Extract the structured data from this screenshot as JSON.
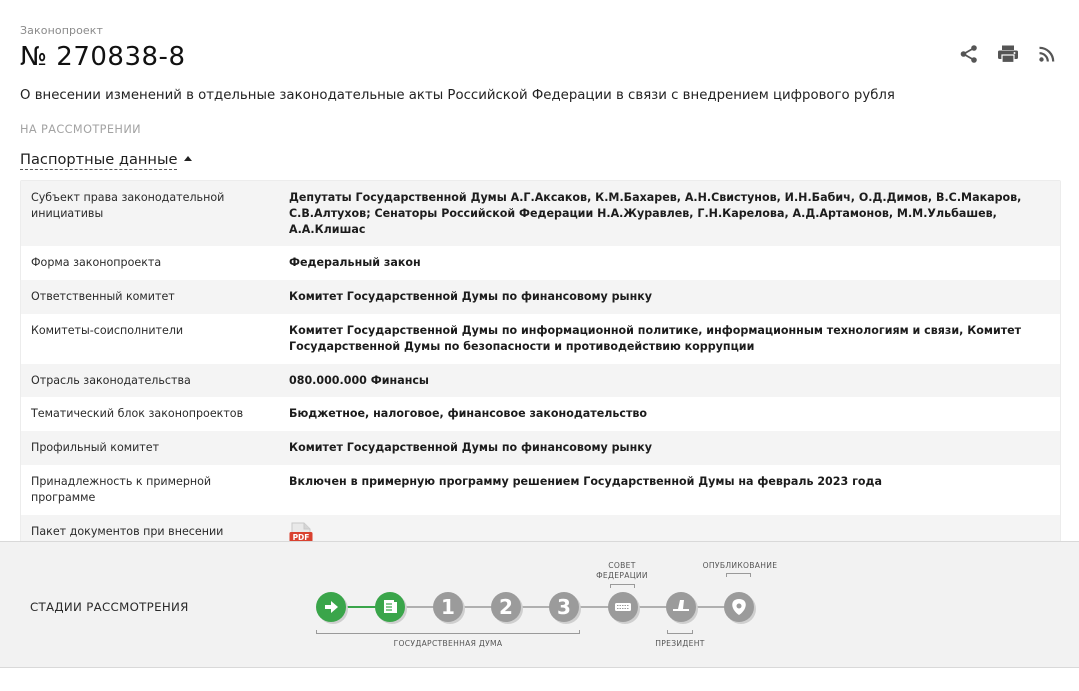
{
  "header": {
    "eyebrow": "Законопроект",
    "number": "№ 270838-8",
    "title": "О внесении изменений в отдельные законодательные акты Российской Федерации в связи с внедрением цифрового рубля",
    "status": "НА РАССМОТРЕНИИ",
    "passport_toggle": "Паспортные данные"
  },
  "tools": {
    "share_icon": "share-icon",
    "print_icon": "print-icon",
    "rss_icon": "rss-icon"
  },
  "passport": {
    "rows": [
      {
        "key": "Субъект права законодательной инициативы",
        "value": "Депутаты Государственной Думы А.Г.Аксаков, К.М.Бахарев, А.Н.Свистунов, И.Н.Бабич, О.Д.Димов, В.С.Макаров, С.В.Алтухов; Сенаторы Российской Федерации Н.А.Журавлев, Г.Н.Карелова, А.Д.Артамонов, М.М.Ульбашев, А.А.Клишас"
      },
      {
        "key": "Форма законопроекта",
        "value": "Федеральный закон"
      },
      {
        "key": "Ответственный комитет",
        "value": "Комитет Государственной Думы по финансовому рынку"
      },
      {
        "key": "Комитеты-соисполнители",
        "value": "Комитет Государственной Думы по информационной политике, информационным технологиям и связи, Комитет Государственной Думы по безопасности и противодействию коррупции"
      },
      {
        "key": "Отрасль законодательства",
        "value": "080.000.000 Финансы"
      },
      {
        "key": "Тематический блок законопроектов",
        "value": "Бюджетное, налоговое, финансовое законодательство"
      },
      {
        "key": "Профильный комитет",
        "value": "Комитет Государственной Думы по финансовому рынку"
      },
      {
        "key": "Принадлежность к примерной программе",
        "value": "Включен в примерную программу решением Государственной Думы на февраль 2023 года"
      },
      {
        "key": "Пакет документов при внесении",
        "value": ""
      }
    ],
    "pdf_label": "PDF"
  },
  "stages": {
    "label": "СТАДИИ РАССМОТРЕНИЯ",
    "duma_label": "ГОСУДАРСТВЕННАЯ ДУМА",
    "federation_council_label_1": "СОВЕТ",
    "federation_council_label_2": "ФЕДЕРАЦИИ",
    "president_label": "ПРЕЗИДЕНТ",
    "publication_label": "ОПУБЛИКОВАНИЕ",
    "steps": [
      {
        "name": "registration",
        "icon": "arrow-right-icon",
        "status": "done"
      },
      {
        "name": "preliminary",
        "icon": "document-list-icon",
        "status": "done"
      },
      {
        "name": "first-reading",
        "text": "1",
        "status": "pending"
      },
      {
        "name": "second-reading",
        "text": "2",
        "status": "pending"
      },
      {
        "name": "third-reading",
        "text": "3",
        "status": "pending"
      },
      {
        "name": "federation-council",
        "icon": "keyboard-icon",
        "status": "pending"
      },
      {
        "name": "president",
        "icon": "signature-icon",
        "status": "pending"
      },
      {
        "name": "publication",
        "icon": "emblem-icon",
        "status": "pending"
      }
    ],
    "colors": {
      "done": "#3aa54a",
      "pending": "#9b9b9b",
      "shadow": "#cfcfcf"
    }
  }
}
